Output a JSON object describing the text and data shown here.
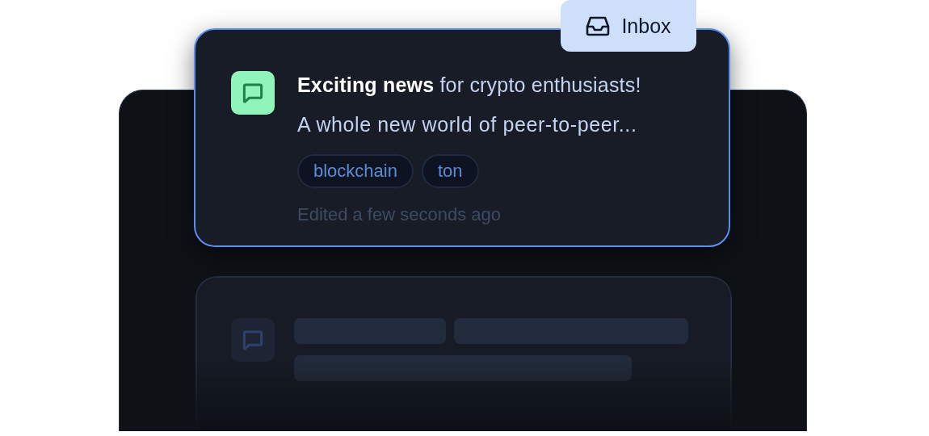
{
  "badge": {
    "label": "Inbox"
  },
  "message": {
    "title": "**Exciting news** for crypto enthusiasts!",
    "preview": "A whole new world of peer-to-peer...",
    "tags": [
      "blockchain",
      "ton"
    ],
    "edited": "Edited a few seconds ago"
  }
}
